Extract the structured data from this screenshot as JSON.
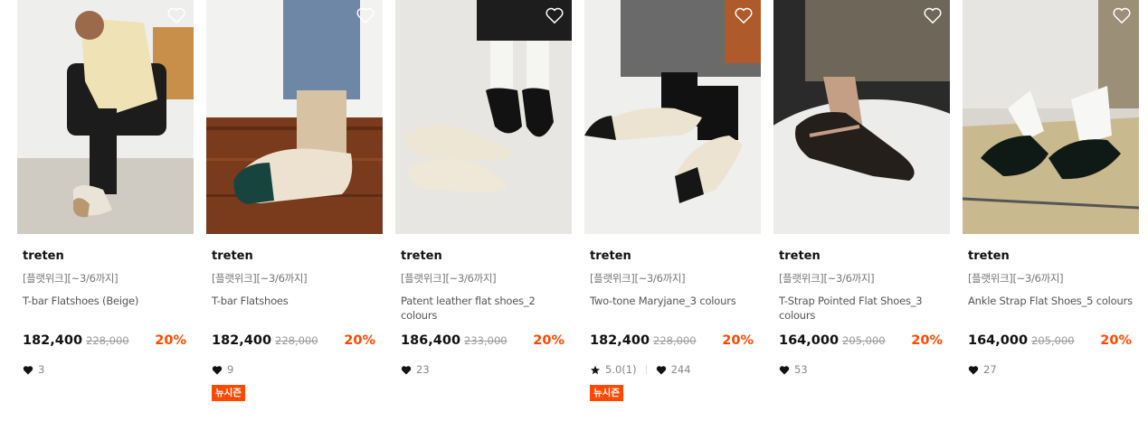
{
  "products": [
    {
      "brand": "treten",
      "promo": "[플랫위크][~3/6까지]",
      "name": "T-bar Flatshoes (Beige)",
      "price": "182,400",
      "original_price": "228,000",
      "discount": "20%",
      "likes": "3",
      "rating": null,
      "badge": null
    },
    {
      "brand": "treten",
      "promo": "[플랫위크][~3/6까지]",
      "name": "T-bar Flatshoes",
      "price": "182,400",
      "original_price": "228,000",
      "discount": "20%",
      "likes": "9",
      "rating": null,
      "badge": "뉴시즌"
    },
    {
      "brand": "treten",
      "promo": "[플랫위크][~3/6까지]",
      "name": "Patent leather flat shoes_2 colours",
      "price": "186,400",
      "original_price": "233,000",
      "discount": "20%",
      "likes": "23",
      "rating": null,
      "badge": null
    },
    {
      "brand": "treten",
      "promo": "[플랫위크][~3/6까지]",
      "name": "Two-tone Maryjane_3 colours",
      "price": "182,400",
      "original_price": "228,000",
      "discount": "20%",
      "likes": "244",
      "rating": "5.0(1)",
      "badge": "뉴시즌"
    },
    {
      "brand": "treten",
      "promo": "[플랫위크][~3/6까지]",
      "name": "T-Strap Pointed Flat Shoes_3 colours",
      "price": "164,000",
      "original_price": "205,000",
      "discount": "20%",
      "likes": "53",
      "rating": null,
      "badge": null
    },
    {
      "brand": "treten",
      "promo": "[플랫위크][~3/6까지]",
      "name": "Ankle Strap Flat Shoes_5 colours",
      "price": "164,000",
      "original_price": "205,000",
      "discount": "20%",
      "likes": "27",
      "rating": null,
      "badge": null
    }
  ],
  "icons": {
    "wishlist": "heart-outline-icon",
    "likes": "heart-filled-icon",
    "rating": "star-icon"
  },
  "colors": {
    "discount": "#ff4800",
    "badge_bg": "#ff4800"
  }
}
